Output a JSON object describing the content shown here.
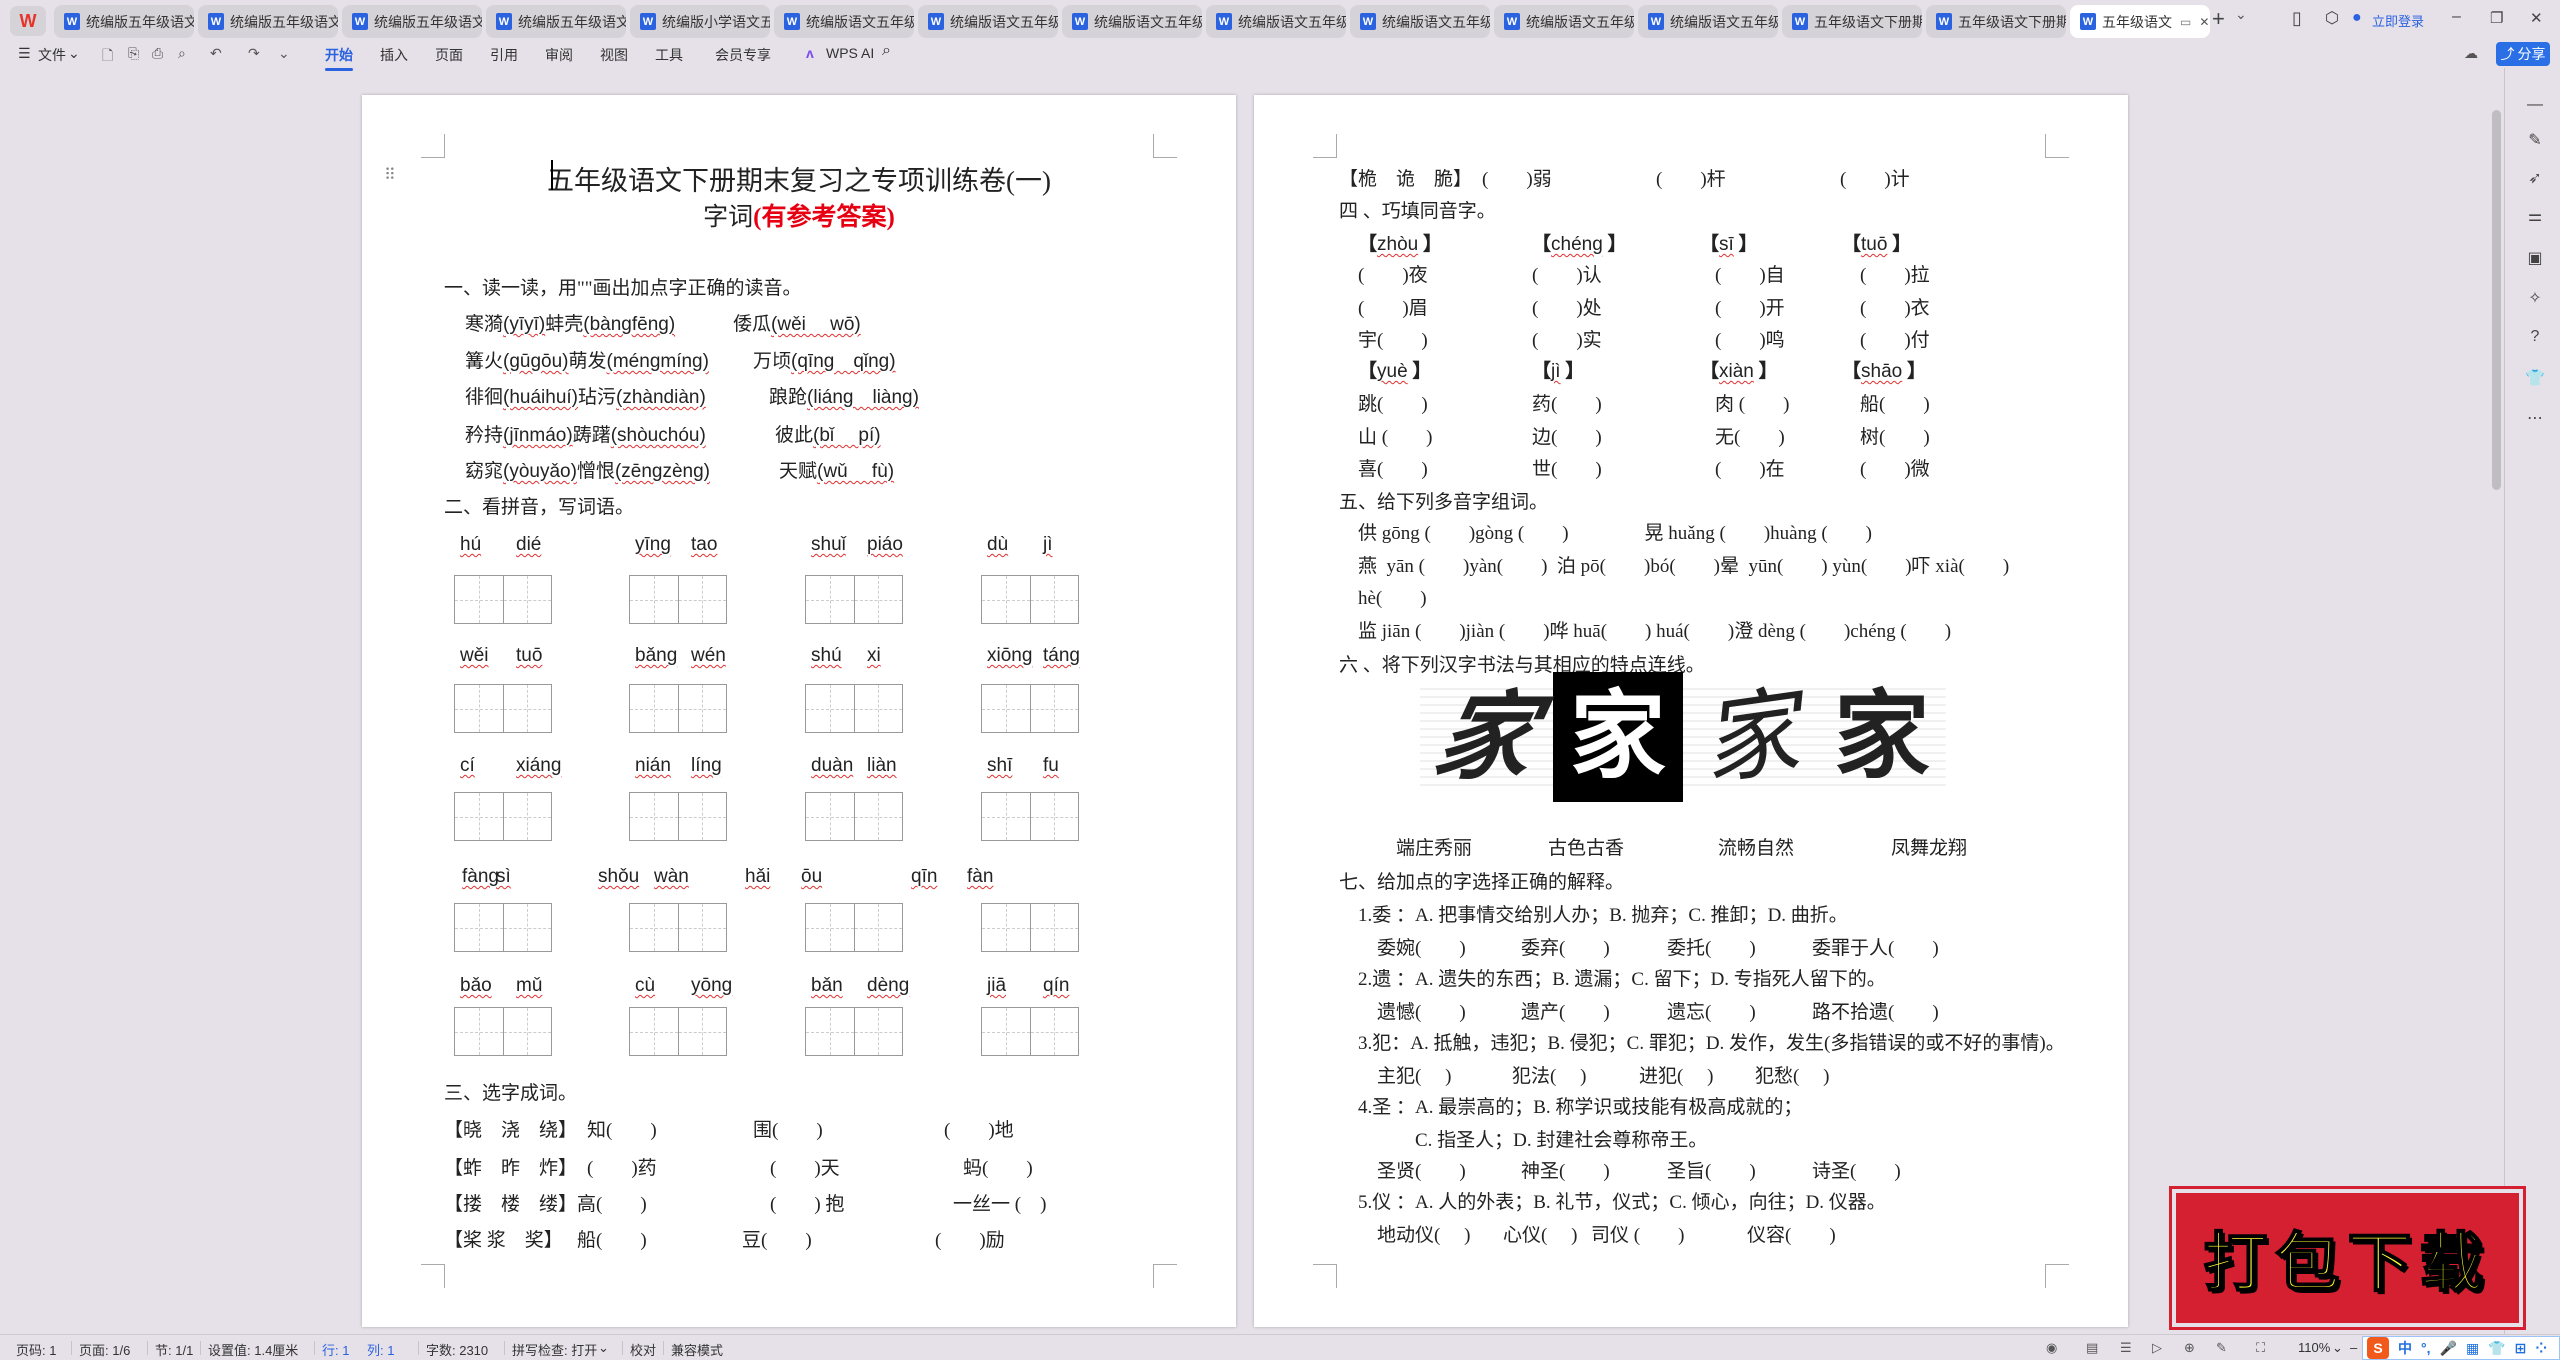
{
  "tabs": [
    {
      "label": "统编版五年级语文"
    },
    {
      "label": "统编版五年级语文"
    },
    {
      "label": "统编版五年级语文"
    },
    {
      "label": "统编版五年级语文"
    },
    {
      "label": "统编版小学语文五"
    },
    {
      "label": "统编版语文五年级"
    },
    {
      "label": "统编版语文五年级"
    },
    {
      "label": "统编版语文五年级"
    },
    {
      "label": "统编版语文五年级"
    },
    {
      "label": "统编版语文五年级"
    },
    {
      "label": "统编版语文五年级"
    },
    {
      "label": "统编版语文五年级"
    },
    {
      "label": "五年级语文下册期"
    },
    {
      "label": "五年级语文下册期"
    },
    {
      "label": "五年级语文",
      "active": true
    }
  ],
  "titlebar": {
    "login": "立即登录",
    "tab_icon": "W",
    "logo": "W"
  },
  "toolbar": {
    "file": "文件",
    "menus": [
      "开始",
      "插入",
      "页面",
      "引用",
      "审阅",
      "视图",
      "工具",
      "会员专享"
    ],
    "active_menu": "开始",
    "wps_ai": "WPS AI",
    "share": "分享"
  },
  "left_page": {
    "title": "五年级语文下册期末复习之专项训练卷(一)",
    "subtitle": "字词",
    "subtitle_red": "(有参考答案)",
    "s1": {
      "heading": "一、读一读，用\"\"画出加点字正确的读音。",
      "rows": [
        {
          "a": "寒漪",
          "ap": "(yīyī)",
          "b": "蚌壳",
          "bp": "(bàngfēng)",
          "c": "倭瓜",
          "cp": "(wěi　 wō)"
        },
        {
          "a": "篝火",
          "ap": "(gūgōu)",
          "b": "萌发",
          "bp": "(méngmíng)",
          "c": "万顷",
          "cp": "(qīng　qǐng)"
        },
        {
          "a": "徘徊",
          "ap": "(huáihuí)",
          "b": "玷污",
          "bp": "(zhàndiàn)",
          "c": "踉跄",
          "cp": "(liáng　liàng)"
        },
        {
          "a": "矜持",
          "ap": "(jīnmáo)",
          "b": "踌躇",
          "bp": "(shòuchóu)",
          "c": "彼此",
          "cp": "(bǐ　 pí)"
        },
        {
          "a": "窈窕",
          "ap": "(yòuyǎo)",
          "b": "憎恨",
          "bp": "(zēngzèng)",
          "c": "天赋",
          "cp": "(wǔ　 fù)"
        }
      ]
    },
    "s2": {
      "heading": "二、看拼音，写词语。",
      "rows": [
        [
          [
            "hú",
            "dié"
          ],
          [
            "yīng",
            "tao"
          ],
          [
            "shuǐ",
            "piáo"
          ],
          [
            "dù",
            "jì"
          ]
        ],
        [
          [
            "wěi",
            "tuō"
          ],
          [
            "bǎng",
            "wén"
          ],
          [
            "shú",
            "xi"
          ],
          [
            "xiōng",
            "táng"
          ]
        ],
        [
          [
            "cí",
            "xiáng"
          ],
          [
            "nián",
            "líng"
          ],
          [
            "duàn",
            "liàn"
          ],
          [
            "shī",
            "fu"
          ]
        ],
        [
          [
            "fàng",
            "sì"
          ],
          [
            "shǒu",
            "wàn"
          ],
          [
            "hǎi",
            "ōu"
          ],
          [
            "qīn",
            "fàn"
          ]
        ],
        [
          [
            "bǎo",
            "mǔ"
          ],
          [
            "cù",
            "yōng"
          ],
          [
            "bǎn",
            "dèng"
          ],
          [
            "jiā",
            "qín"
          ]
        ]
      ]
    },
    "s3": {
      "heading": "三、选字成词。",
      "rows": [
        {
          "bracket": "【晓　浇　绕】",
          "items": [
            "知(　　)",
            "围(　　)",
            "(　　)地"
          ]
        },
        {
          "bracket": "【蚱　昨　炸】",
          "items": [
            "(　　)药",
            "(　　)天",
            "蚂(　　)"
          ]
        },
        {
          "bracket": "【搂　楼　缕】",
          "items": [
            "高(　　)",
            "(　　) 抱",
            "一丝一 (　)"
          ]
        },
        {
          "bracket": "【桨 浆　奖】",
          "items": [
            "船(　　)",
            "豆(　　)",
            "(　　)励"
          ]
        }
      ]
    }
  },
  "right_page": {
    "s3_last": {
      "bracket": "【桅　诡　脆】",
      "items": [
        "(　　)弱",
        "(　　)杆",
        "(　　)计"
      ]
    },
    "s4": {
      "heading": "四 、巧填同音字。",
      "groups": [
        {
          "headers": [
            "zhòu",
            "chéng",
            "sī",
            "tuō"
          ],
          "rows": [
            [
              "(　　)夜",
              "(　　)认",
              "(　　)自",
              "(　　)拉"
            ],
            [
              "(　　)眉",
              "(　　)处",
              "(　　)开",
              "(　　)衣"
            ],
            [
              "宇(　　)",
              "(　　)实",
              "(　　)鸣",
              "(　　)付"
            ]
          ]
        },
        {
          "headers": [
            "yuè",
            "jì",
            "xiàn",
            "shāo"
          ],
          "rows": [
            [
              "跳(　　)",
              "药(　　)",
              "肉 (　　)",
              "船(　　)"
            ],
            [
              "山 (　　)",
              "边(　　)",
              "无(　　)",
              "树(　　)"
            ],
            [
              "喜(　　)",
              "世(　　)",
              "(　　)在",
              "(　　)微"
            ]
          ]
        }
      ]
    },
    "s5": {
      "heading": "五、给下列多音字组词。",
      "lines": [
        "供 gōng (　　)gòng (　　)　　　　晃 huǎng (　　)huàng (　　)",
        "燕  yān (　　)yàn(　　)  泊 pō(　　)bó(　　)晕  yūn(　　) yùn(　　)吓 xià(　　)",
        "hè(　　)",
        "监 jiān (　　)jiàn (　　)哗 huā(　　) huá(　　)澄 dèng (　　)chéng (　　)"
      ]
    },
    "s6": {
      "heading": "六 、将下列汉字书法与其相应的特点连线。",
      "characters": [
        "家",
        "家",
        "家",
        "家"
      ],
      "labels": [
        "端庄秀丽",
        "古色古香",
        "流畅自然",
        "凤舞龙翔"
      ]
    },
    "s7": {
      "heading": "七、给加点的字选择正确的解释。",
      "items": [
        {
          "def": "1.委 ：A. 把事情交给别人办；B. 抛弃；C. 推卸；D. 曲折。",
          "words": [
            "委婉(　　)",
            "委弃(　　)",
            "委托(　　)",
            "委罪于人(　　)"
          ]
        },
        {
          "def": "2.遗 ：A. 遗失的东西；B. 遗漏；C. 留下；D. 专指死人留下的。",
          "words": [
            "遗憾(　　)",
            "遗产(　　)",
            "遗忘(　　)",
            "路不拾遗(　　)"
          ]
        },
        {
          "def": "3.犯：A. 抵触，违犯；B. 侵犯；C. 罪犯；D. 发作，发生(多指错误的或不好的事情)。",
          "words": [
            "主犯(　 )",
            "犯法(　 )",
            "进犯(　 )",
            "犯愁(　 )"
          ]
        },
        {
          "def": "4.圣 ：A. 最崇高的；B. 称学识或技能有极高成就的；",
          "def2": "C. 指圣人；D. 封建社会尊称帝王。",
          "words": [
            "圣贤(　　)",
            "神圣(　　)",
            "圣旨(　　)",
            "诗圣(　　)"
          ]
        },
        {
          "def": "5.仪 ：A. 人的外表；B. 礼节，仪式；C. 倾心，向往；D. 仪器。",
          "words": [
            "地动仪(　 )",
            "心仪(　 )",
            "司仪 (　　)",
            "仪容(　　)"
          ]
        }
      ]
    }
  },
  "status": {
    "left": [
      "页码: 1",
      "页面: 1/6",
      "节: 1/1",
      "设置值: 1.4厘米",
      "行: 1",
      "列: 1",
      "字数: 2310",
      "拼写检查: 打开",
      "校对",
      "兼容模式"
    ],
    "zoom": "110%"
  },
  "ime": {
    "logo": "S",
    "mode": "中"
  },
  "banner": {
    "text": "打包下载"
  },
  "colors": {
    "accent": "#2a62e0",
    "red_title": "#e60012",
    "banner_red": "#d42030",
    "banner_text": "#ffff33",
    "pinyin_underline": "#e03030"
  }
}
